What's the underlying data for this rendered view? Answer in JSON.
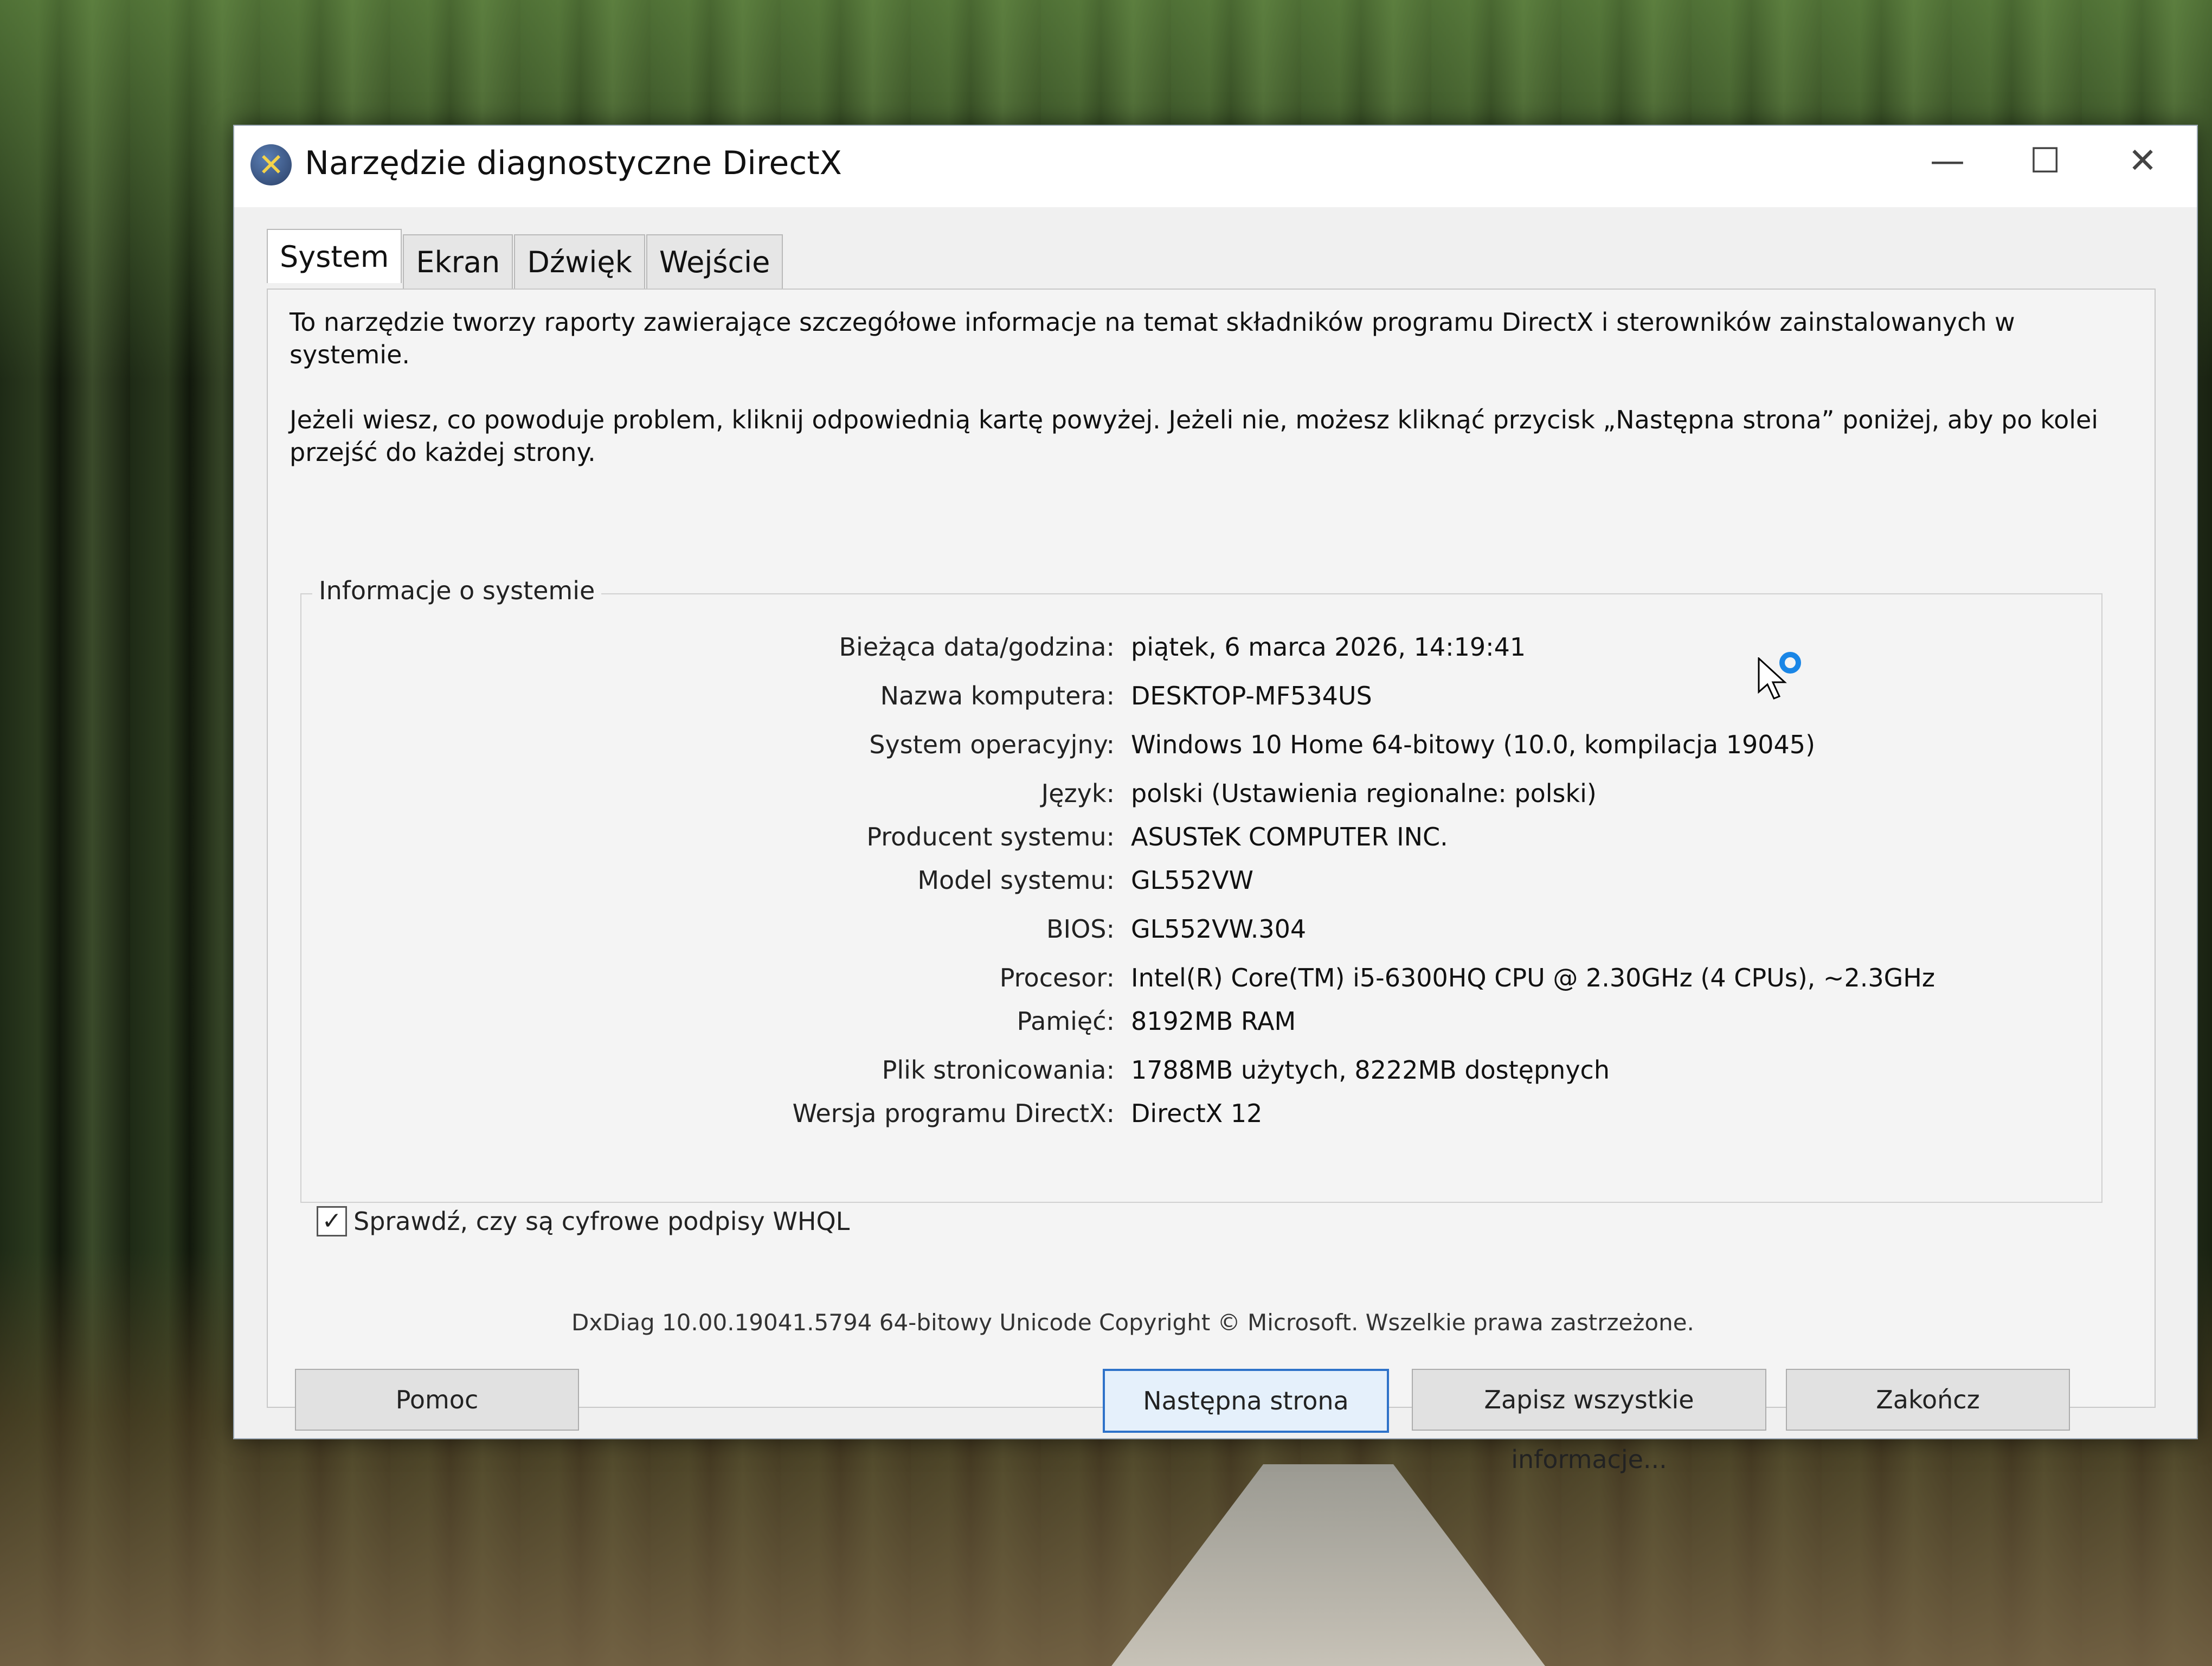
{
  "window": {
    "title": "Narzędzie diagnostyczne DirectX",
    "controls": {
      "minimize": "—",
      "maximize": "☐",
      "close": "✕"
    }
  },
  "tabs": [
    "System",
    "Ekran",
    "Dźwięk",
    "Wejście"
  ],
  "intro": {
    "line1": "To narzędzie tworzy raporty zawierające szczegółowe informacje na temat składników programu DirectX i sterowników zainstalowanych w systemie.",
    "line2": "Jeżeli wiesz, co powoduje problem, kliknij odpowiednią kartę powyżej. Jeżeli nie, możesz kliknąć przycisk „Następna strona” poniżej, aby po kolei przejść do każdej strony."
  },
  "system_info": {
    "group_label": "Informacje o systemie",
    "rows": [
      {
        "label": "Bieżąca data/godzina:",
        "value": "piątek, 6 marca 2026, 14:19:41"
      },
      {
        "label": "Nazwa komputera:",
        "value": "DESKTOP-MF534US"
      },
      {
        "label": "System operacyjny:",
        "value": "Windows 10 Home 64-bitowy (10.0, kompilacja 19045)"
      },
      {
        "label": "Język:",
        "value": "polski (Ustawienia regionalne: polski)"
      },
      {
        "label": "Producent systemu:",
        "value": "ASUSTeK COMPUTER INC."
      },
      {
        "label": "Model systemu:",
        "value": "GL552VW"
      },
      {
        "label": "BIOS:",
        "value": "GL552VW.304"
      },
      {
        "label": "Procesor:",
        "value": "Intel(R) Core(TM) i5-6300HQ CPU @ 2.30GHz (4 CPUs), ~2.3GHz"
      },
      {
        "label": "Pamięć:",
        "value": "8192MB RAM"
      },
      {
        "label": "Plik stronicowania:",
        "value": "1788MB użytych, 8222MB dostępnych"
      },
      {
        "label": "Wersja programu DirectX:",
        "value": "DirectX 12"
      }
    ]
  },
  "whql_check": {
    "label": "Sprawdź, czy są cyfrowe podpisy WHQL",
    "checked": true,
    "mark": "✓"
  },
  "footer_info": "DxDiag 10.00.19041.5794 64-bitowy Unicode  Copyright © Microsoft. Wszelkie prawa zastrzeżone.",
  "buttons": {
    "help": "Pomoc",
    "next": "Następna strona",
    "save": "Zapisz wszystkie informacje...",
    "exit": "Zakończ"
  }
}
